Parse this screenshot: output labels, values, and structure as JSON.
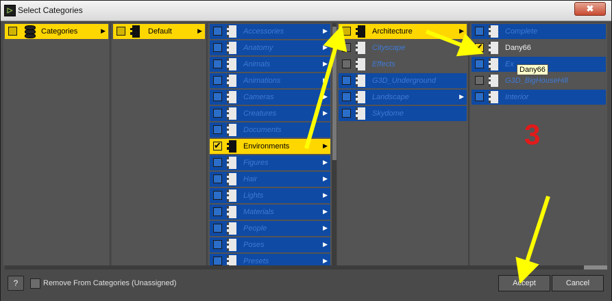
{
  "window": {
    "title": "Select Categories",
    "close_symbol": "✖",
    "app_icon_symbol": "▷"
  },
  "columns": {
    "c1": [
      {
        "label": "Categories",
        "icon": "database-stack-icon",
        "state": "yellow",
        "arrow": true
      }
    ],
    "c2": [
      {
        "label": "Default",
        "icon": "document-icon",
        "state": "yellow",
        "arrow": true
      }
    ],
    "c3": [
      {
        "label": "Accessories",
        "arrow": true
      },
      {
        "label": "Anatomy",
        "arrow": true
      },
      {
        "label": "Animals",
        "arrow": true
      },
      {
        "label": "Animations",
        "arrow": true
      },
      {
        "label": "Cameras",
        "arrow": true
      },
      {
        "label": "Creatures",
        "arrow": true
      },
      {
        "label": "Documents",
        "arrow": false
      },
      {
        "label": "Environments",
        "arrow": true,
        "state": "yellow",
        "checked": true
      },
      {
        "label": "Figures",
        "arrow": true
      },
      {
        "label": "Hair",
        "arrow": true
      },
      {
        "label": "Lights",
        "arrow": true
      },
      {
        "label": "Materials",
        "arrow": true
      },
      {
        "label": "People",
        "arrow": true
      },
      {
        "label": "Poses",
        "arrow": true
      },
      {
        "label": "Presets",
        "arrow": true
      }
    ],
    "c4": [
      {
        "label": "Architecture",
        "arrow": true,
        "state": "yellow"
      },
      {
        "label": "Cityscape",
        "arrow": false,
        "state": "none"
      },
      {
        "label": "Effects",
        "arrow": false,
        "state": "none"
      },
      {
        "label": "G3D_Underground",
        "arrow": false
      },
      {
        "label": "Landscape",
        "arrow": true
      },
      {
        "label": "Skydome",
        "arrow": false
      }
    ],
    "c5": [
      {
        "label": "Complete",
        "arrow": false
      },
      {
        "label": "Dany66",
        "arrow": false,
        "state": "plain",
        "checked": true
      },
      {
        "label": "Ex",
        "arrow": false
      },
      {
        "label": "G3D_BigHouseHill",
        "arrow": false,
        "state": "none"
      },
      {
        "label": "Interior",
        "arrow": false
      }
    ]
  },
  "tooltip": "Dany66",
  "annotation_number": "3",
  "footer": {
    "help_label": "?",
    "remove_label": "Remove From Categories (Unassigned)",
    "accept_label": "Accept",
    "cancel_label": "Cancel"
  },
  "colors": {
    "selected_yellow": "#ffd700",
    "item_blue": "#0f4aa4",
    "annotation_yellow": "#ffff00",
    "annotation_red": "#e21a1a"
  }
}
